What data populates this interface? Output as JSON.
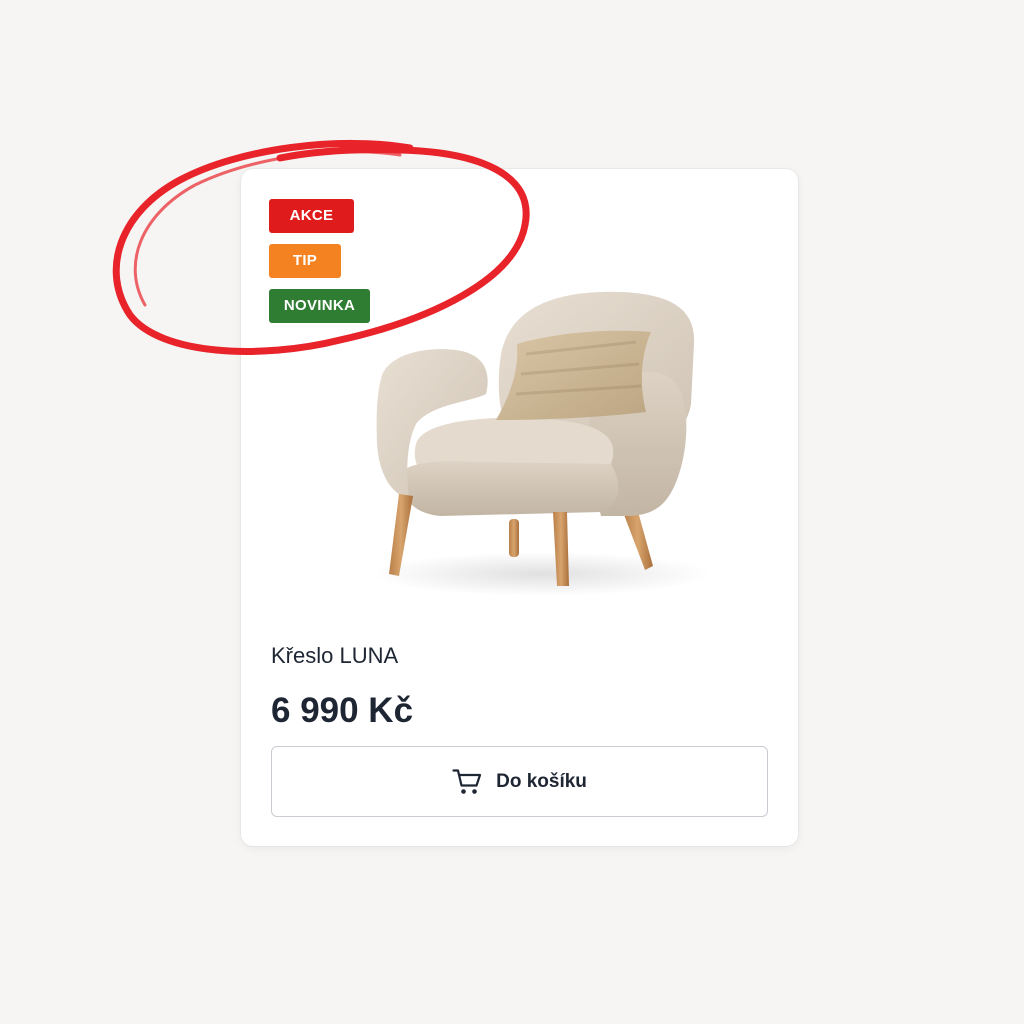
{
  "product": {
    "badges": [
      {
        "label": "AKCE",
        "color": "#e01b1b"
      },
      {
        "label": "TIP",
        "color": "#f58220"
      },
      {
        "label": "NOVINKA",
        "color": "#2e7d32"
      }
    ],
    "image_icon": "armchair-image",
    "name": "Křeslo LUNA",
    "price": "6 990 Kč",
    "cart_button": {
      "label": "Do košíku",
      "icon": "cart-icon"
    }
  },
  "annotation": {
    "circle_color": "#e8232a"
  }
}
